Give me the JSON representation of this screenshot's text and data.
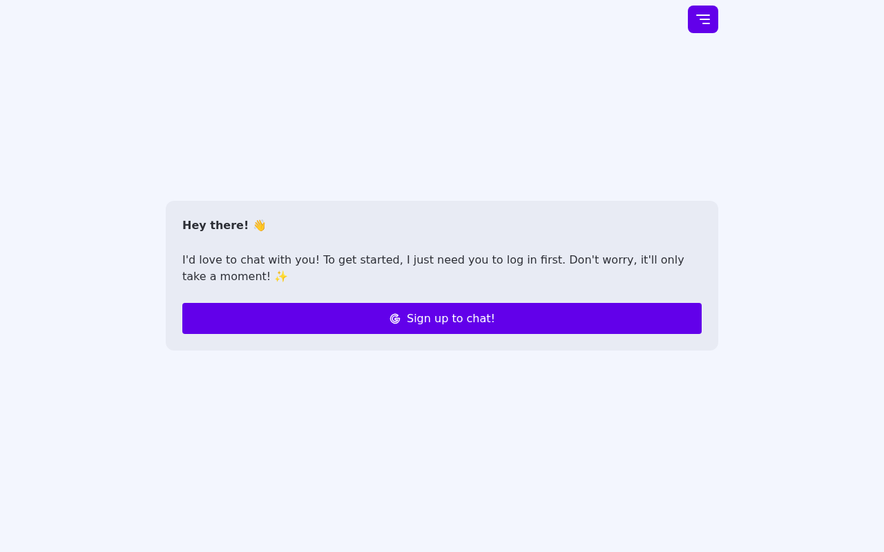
{
  "card": {
    "greeting": "Hey there! 👋",
    "message": "I'd love to chat with you! To get started, I just need you to log in first. Don't worry, it'll only take a moment! ✨",
    "button": "Sign up to chat!"
  }
}
